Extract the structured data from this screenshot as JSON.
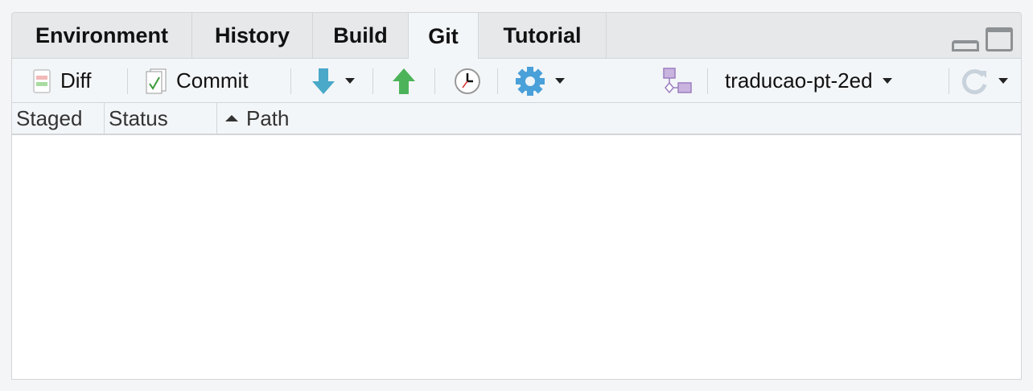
{
  "tabs": [
    {
      "label": "Environment"
    },
    {
      "label": "History"
    },
    {
      "label": "Build"
    },
    {
      "label": "Git",
      "active": true
    },
    {
      "label": "Tutorial"
    }
  ],
  "toolbar": {
    "diff": "Diff",
    "commit": "Commit",
    "branch": "traducao-pt-2ed"
  },
  "columns": {
    "staged": "Staged",
    "status": "Status",
    "path": "Path"
  },
  "colors": {
    "accent_pull": "#4aa9c9",
    "accent_push": "#4cb35a",
    "branch_icon": "#9b7fc0"
  }
}
